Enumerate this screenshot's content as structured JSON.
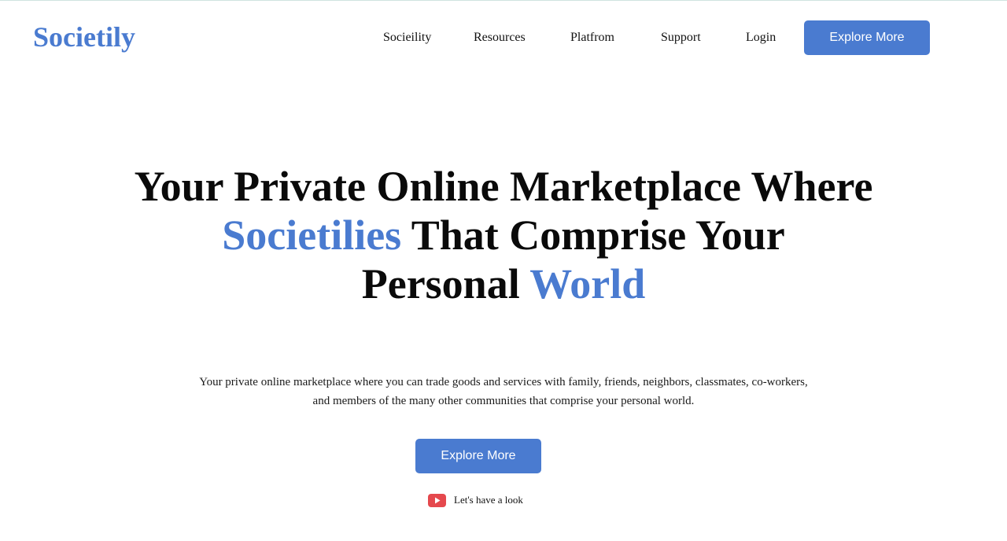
{
  "brand": {
    "name": "Societily"
  },
  "nav": {
    "items": [
      {
        "label": "Socieility"
      },
      {
        "label": "Resources"
      },
      {
        "label": "Platfrom"
      },
      {
        "label": "Support"
      },
      {
        "label": "Login"
      }
    ],
    "cta_label": "Explore More"
  },
  "hero": {
    "line1": "Your Private Online Marketplace Where",
    "line2_highlight": "Societilies",
    "line2_rest": " That Comprise Your",
    "line3_prefix": "Personal ",
    "line3_highlight": "World"
  },
  "subtitle": {
    "line1": "Your private online marketplace where you can trade goods and services with family, friends, neighbors, classmates, co-workers,",
    "line2": "and members of the many other communities that comprise your personal world."
  },
  "cta": {
    "label": "Explore More"
  },
  "video_link": {
    "icon": "youtube-play-icon",
    "label": "Let's have a look"
  },
  "colors": {
    "accent": "#4a7bd0",
    "text": "#0a0a0a",
    "youtube_red": "#e5484d"
  }
}
